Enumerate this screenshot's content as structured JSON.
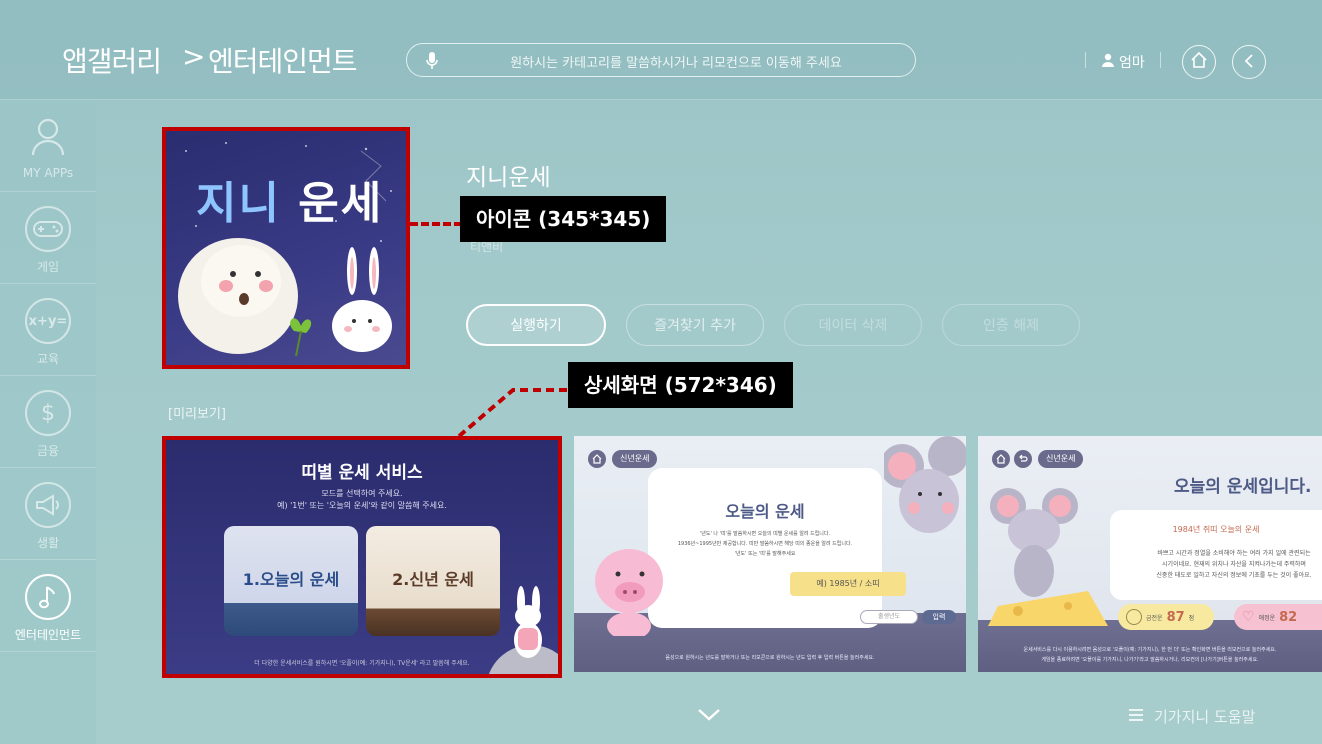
{
  "header": {
    "crumb1": "앱갤러리",
    "crumb_sep": ">",
    "crumb2": "엔터테인먼트",
    "voice_placeholder": "원하시는 카테고리를 말씀하시거나 리모컨으로 이동해 주세요",
    "user_name": "엄마"
  },
  "sidebar": {
    "items": [
      {
        "label": "MY APPs",
        "icon": "person-icon"
      },
      {
        "label": "게임",
        "icon": "gamepad-icon"
      },
      {
        "label": "교육",
        "icon": "math-icon"
      },
      {
        "label": "금융",
        "icon": "dollar-icon"
      },
      {
        "label": "생활",
        "icon": "megaphone-icon"
      },
      {
        "label": "엔터테인먼트",
        "icon": "music-note-icon"
      }
    ]
  },
  "app": {
    "icon_text_a": "지니",
    "icon_text_b": "운세",
    "title": "지니운세",
    "subtitle": "티앤비"
  },
  "annotations": {
    "icon_size": "아이콘 (345*345)",
    "detail_size": "상세화면 (572*346)"
  },
  "actions": [
    "실행하기",
    "즐겨찾기 추가",
    "데이터 삭제",
    "인증 해제"
  ],
  "preview": {
    "label": "[미리보기]",
    "shot1": {
      "title": "띠별 운세 서비스",
      "line1": "모드를 선택하여 주세요.",
      "line2": "예) '1번' 또는 '오늘의 운세'와 같이 말씀해 주세요.",
      "card1": "1.오늘의 운세",
      "card2": "2.신년 운세",
      "footer": "더 다양한 운세서비스를 원하시면 '오플이(예: 기가지니), TV운세' 라고 말씀해 주세요."
    },
    "shot2": {
      "tag": "신년운세",
      "title": "오늘의 운세",
      "body1": "'년도' 나 '띠'를 말씀하시면 오늘의 띠별 운세를 알려 드립니다.",
      "body2": "1936년~1995년만 제공합니다. 띠만 말씀하시면 해당 띠의 종운을 알려 드립니다.",
      "body3": "'년도' 또는 '띠'를 말해주세요",
      "example": "예) 1985년 / 소띠",
      "input_placeholder": "출생년도",
      "input_btn": "입력",
      "footer": "음성으로 원하시는 년도를 말하거나 또는 리모콘으로 원하시는 년도 입력 후 입력 버튼을 눌러주세요."
    },
    "shot3": {
      "tag": "신년운세",
      "title": "오늘의 운세입니다.",
      "subtitle": "1984년 쥐띠 오늘의 운세",
      "body1": "바쁘고 시간과 정열을 소비해야 하는 여러 가지 일에 관련되는",
      "body2": "시기이네요. 현재의 위치나 자산을 지켜나가는데 주력하며",
      "body3": "신중한 태도로 일하고 자신의 정보에 기초를 두는 것이 좋아요.",
      "money_label": "금전운",
      "money_value": "87",
      "money_unit": "점",
      "love_label": "애정운",
      "love_value": "82",
      "footer1": "운세서비스를 다시 이용하시려면 음성으로 '오플이(예: 기가지니), 한 번 더' 또는 확인화면 버튼을 리모컨으로 눌러주세요.",
      "footer2": "게임을 종료하려면 '오플이를 기가지니, 나가기'라고 말씀하시거나, 리모컨의 [나가기]버튼을 눌러주세요."
    }
  },
  "bottom": {
    "help": "기가지니 도움말"
  }
}
